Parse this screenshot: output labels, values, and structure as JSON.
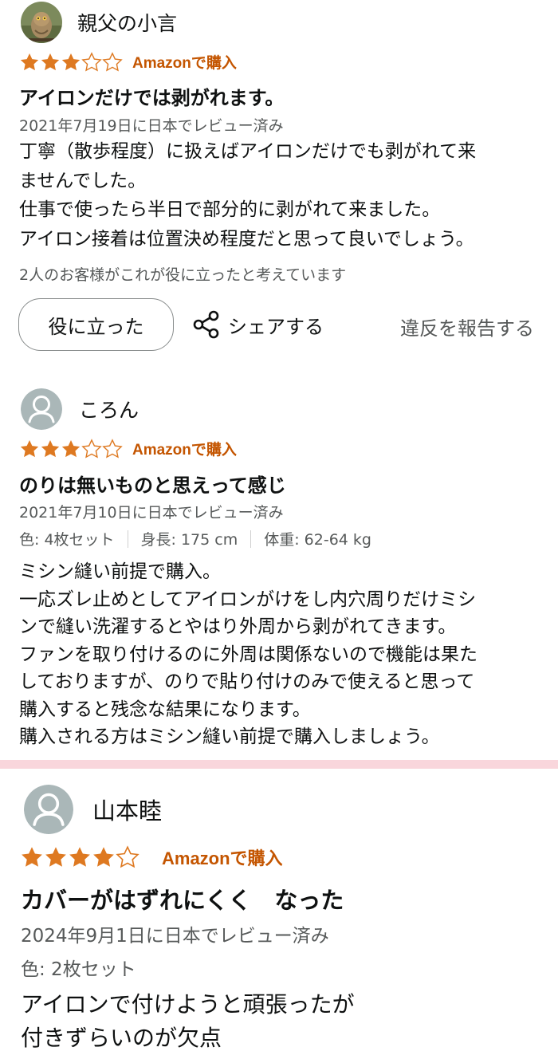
{
  "reviews": [
    {
      "reviewer": "親父の小言",
      "avatar_type": "owl-photo",
      "rating": 3,
      "badge": "Amazonで購入",
      "title": "アイロンだけでは剥がれます。",
      "date": "2021年7月19日に日本でレビュー済み",
      "body_lines": [
        "丁寧（散歩程度）に扱えばアイロンだけでも剥がれて来",
        "ませんでした。",
        "仕事で使ったら半日で部分的に剥がれて来ました。",
        "アイロン接着は位置決め程度だと思って良いでしょう。"
      ],
      "helpful_count": "2人のお客様がこれが役に立ったと考えています",
      "helpful_button": "役に立った",
      "share_label": "シェアする",
      "report_label": "違反を報告する"
    },
    {
      "reviewer": "ころん",
      "avatar_type": "default",
      "rating": 3,
      "badge": "Amazonで購入",
      "title": "のりは無いものと思えって感じ",
      "date": "2021年7月10日に日本でレビュー済み",
      "variants": [
        "色: 4枚セット",
        "身長: 175 cm",
        "体重: 62-64 kg"
      ],
      "body_lines": [
        "ミシン縫い前提で購入。",
        "一応ズレ止めとしてアイロンがけをし内穴周りだけミシ",
        "ンで縫い洗濯するとやはり外周から剥がれてきます。",
        "ファンを取り付けるのに外周は関係ないので機能は果た",
        "しておりますが、のりで貼り付けのみで使えると思って",
        "購入すると残念な結果になります。",
        "購入される方はミシン縫い前提で購入しましょう。"
      ]
    },
    {
      "reviewer": "山本睦",
      "avatar_type": "default",
      "rating": 4,
      "badge": "Amazonで購入",
      "title": "カバーがはずれにくく　なった",
      "date": "2024年9月1日に日本でレビュー済み",
      "variants": [
        "色: 2枚セット"
      ],
      "body_lines": [
        "アイロンで付けようと頑張ったが",
        "付きずらいのが欠点"
      ]
    }
  ],
  "colors": {
    "star": "#de7921",
    "badge": "#c45500",
    "secondary_text": "#565959",
    "divider": "#f9d6dc"
  },
  "icons": {
    "star_filled": "star-filled-icon",
    "star_empty": "star-empty-icon",
    "share": "share-icon",
    "avatar_default": "default-avatar-icon"
  }
}
